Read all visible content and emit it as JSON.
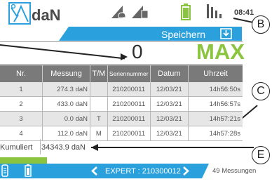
{
  "header": {
    "unit": "daN",
    "time": "08:41"
  },
  "toolbar": {
    "save_label": "Speichern"
  },
  "display": {
    "reading": "0",
    "mode": "MAX"
  },
  "table": {
    "columns": [
      "Nr.",
      "Messung",
      "T/M",
      "Seriennummer",
      "Datum",
      "Uhrzeit"
    ],
    "rows": [
      [
        "1",
        "274.3 daN",
        "",
        "210200011",
        "12/03/21",
        "14h56:50s"
      ],
      [
        "2",
        "433.0 daN",
        "",
        "210200011",
        "12/03/21",
        "14h56:57s"
      ],
      [
        "3",
        "0.0 daN",
        "T",
        "210200011",
        "12/03/21",
        "14h57:21s"
      ],
      [
        "4",
        "112.0 daN",
        "M",
        "210200011",
        "12/03/21",
        "14h57:28s"
      ]
    ]
  },
  "summary": {
    "label": "Kumuliert",
    "value": "34343.9 daN"
  },
  "footer": {
    "device": "EXPERT : 210300012",
    "count": "49 Messungen"
  },
  "callouts": [
    "B",
    "C",
    "E"
  ],
  "colors": {
    "accent_blue": "#2aa1dc",
    "max_green": "#8bc53f",
    "header_gray": "#7a7a7a"
  }
}
